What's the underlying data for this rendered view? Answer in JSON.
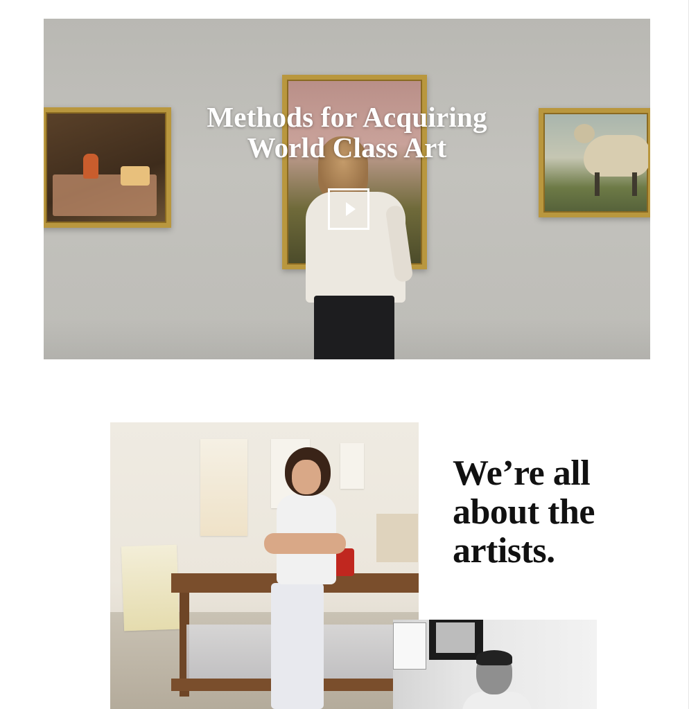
{
  "hero": {
    "title_line1": "Methods for Acquiring",
    "title_line2": "World Class Art",
    "play_icon": "play-icon"
  },
  "artists_section": {
    "headline_line1": "We’re all",
    "headline_line2": "about the",
    "headline_line3": "artists."
  },
  "colors": {
    "headline_text": "#111111",
    "hero_text": "#ffffff",
    "frame_gold": "#b9973e",
    "background": "#ffffff"
  }
}
